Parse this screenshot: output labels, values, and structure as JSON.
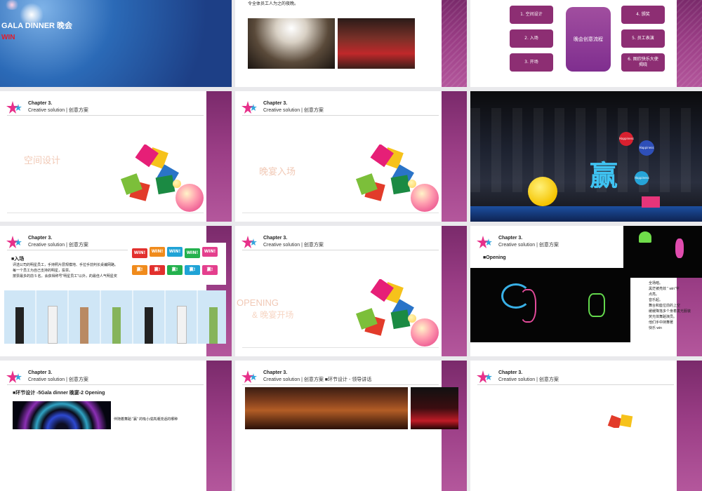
{
  "slides": {
    "s1": {
      "title": "GALA DINNER  晚会",
      "sub": "WIN"
    },
    "s2": {
      "caption": "令全体员工人为之的夜晚。"
    },
    "s3": {
      "boxes": [
        "1. 空间设计",
        "2. 入场",
        "3. 开场",
        "4. 颁奖",
        "5. 员工表演",
        "6. 图欣快乐大使\n揭晓"
      ],
      "center": "晚会创意流程"
    },
    "s4": {
      "chapter": "Chapter 3.",
      "subtitle": "Creative solution |  创意方案",
      "ghost": "空间设计"
    },
    "s5": {
      "chapter": "Chapter 3.",
      "subtitle": "Creative solution |  创意方案",
      "ghost": "晚宴入场"
    },
    "s6": {
      "balloon1": "Happiness",
      "balloon2": "Happiness",
      "balloon3": "Happiness",
      "sign": "赢"
    },
    "s7": {
      "chapter": "Chapter 3.",
      "subtitle": "Creative solution |  创意方案",
      "heading": "■入场",
      "lines": [
        "评选公司的明星员工，手持照片层规模地、手拉手前判长桌编网路。",
        "每一个员工为自己支持的明星，投票。",
        "按票最多的前 5 名，会获得称号“明星员工”以外，的最佳人气明星奖"
      ],
      "wins": [
        "WIN!",
        "WIN!",
        "WIN!",
        "WIN!",
        "WIN!",
        "赢!",
        "赢!",
        "赢!",
        "赢!",
        "赢!"
      ]
    },
    "s8": {
      "chapter": "Chapter 3.",
      "subtitle": "Creative solution |  创意方案",
      "ghost1": "OPENING",
      "ghost2": "& 晚宴开场"
    },
    "s9": {
      "chapter": "Chapter 3.",
      "subtitle": "Creative solution |  创意方案",
      "heading": "■Opening",
      "lines": [
        "全场暗。",
        "黑茫被亮效 “ win”字",
        "点亮。",
        "音乐起。",
        "舞台和座位前的上空",
        "缓缓降落多个身着发光服装",
        "荧光体舞蹈演员。",
        "他们手中持舞著",
        "快乐  win"
      ]
    },
    "s10": {
      "chapter": "Chapter 3.",
      "subtitle": "Creative solution |  创意方案",
      "heading": "■环节设计 -5Gala dinner  晚宴-2 Opening",
      "body": "伴随着舞蹈 “赢” 的吸小成高潮流话的哪种"
    },
    "s11": {
      "chapter": "Chapter 3.",
      "subtitle": "Creative solution |  创意方案  ■环节设计 - 领导讲话"
    },
    "s12": {
      "chapter": "Chapter 3.",
      "subtitle": "Creative solution |  创意方案"
    }
  }
}
